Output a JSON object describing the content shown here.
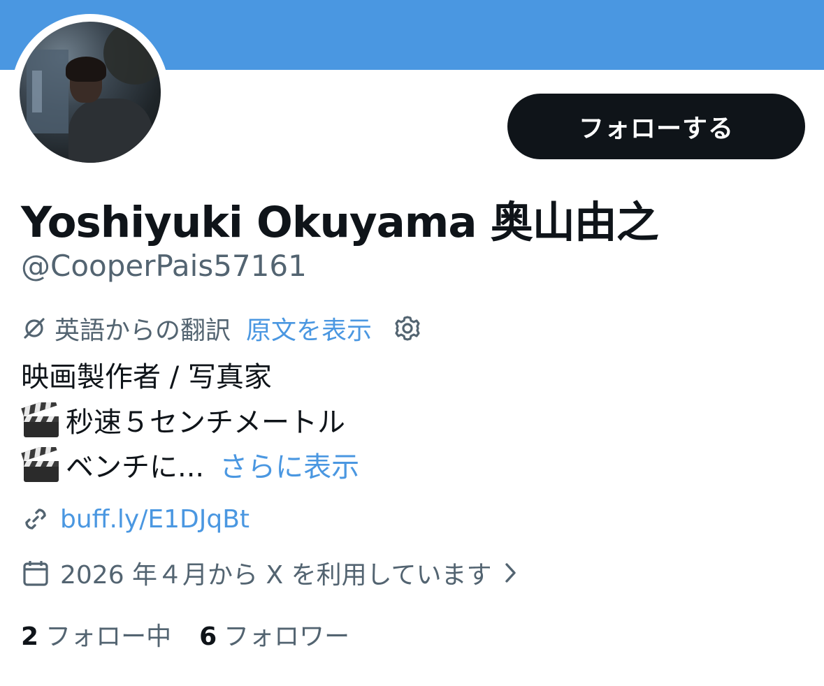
{
  "header": {
    "banner_color": "#4a97e1",
    "follow_label": "フォローする"
  },
  "profile": {
    "display_name": "Yoshiyuki Okuyama 奥山由之",
    "handle": "@CooperPais57161",
    "avatar_icon": "profile-photo"
  },
  "translation": {
    "label": "英語からの翻訳",
    "show_original": "原文を表示",
    "icon": "translate-icon",
    "settings_icon": "gear-icon"
  },
  "bio": {
    "line1": "映画製作者 / 写真家",
    "line2": "秒速５センチメートル",
    "line3": "ベンチに...",
    "show_more": "さらに表示",
    "emoji_icon": "clapperboard-icon"
  },
  "url": {
    "text": "buff.ly/E1DJqBt",
    "icon": "link-icon"
  },
  "joined": {
    "text": "2026 年４月から X を利用しています",
    "icon": "calendar-icon",
    "chevron_icon": "chevron-right-icon"
  },
  "stats": {
    "following_count": "2",
    "following_label": "フォロー中",
    "followers_count": "6",
    "followers_label": "フォロワー"
  },
  "colors": {
    "text": "#0f1419",
    "muted": "#536471",
    "link": "#4a97e1",
    "button": "#0f1419"
  }
}
